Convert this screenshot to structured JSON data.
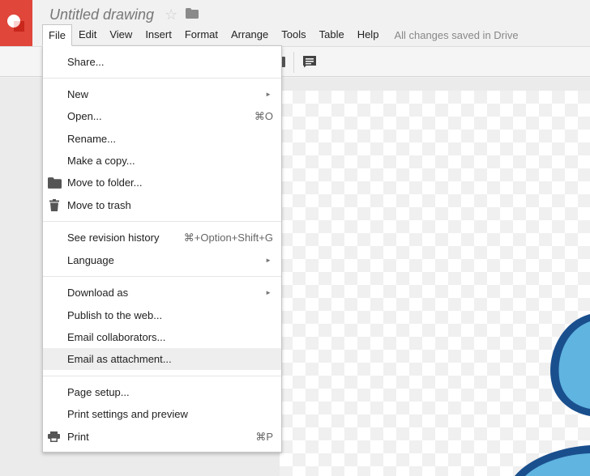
{
  "app": {
    "logo": "drawings-logo-icon",
    "brand_color": "#e0463a"
  },
  "document": {
    "title": "Untitled drawing",
    "star_icon": "☆",
    "folder_icon": "folder-icon"
  },
  "menubar": {
    "items": [
      "File",
      "Edit",
      "View",
      "Insert",
      "Format",
      "Arrange",
      "Tools",
      "Table",
      "Help"
    ],
    "active": "File",
    "save_status": "All changes saved in Drive"
  },
  "file_menu": {
    "share": "Share...",
    "new": "New",
    "open": "Open...",
    "open_shortcut": "⌘O",
    "rename": "Rename...",
    "make_copy": "Make a copy...",
    "move_to_folder": "Move to folder...",
    "move_to_trash": "Move to trash",
    "revision_history": "See revision history",
    "revision_shortcut": "⌘+Option+Shift+G",
    "language": "Language",
    "download_as": "Download as",
    "publish": "Publish to the web...",
    "email_collaborators": "Email collaborators...",
    "email_attachment": "Email as attachment...",
    "page_setup": "Page setup...",
    "print_settings": "Print settings and preview",
    "print": "Print",
    "print_shortcut": "⌘P",
    "submenu_arrow": "►",
    "highlighted": "Email as attachment..."
  },
  "colors": {
    "accent": "#e0463a",
    "shape_fill": "#5fb4e0",
    "shape_stroke": "#1a4f8e"
  }
}
